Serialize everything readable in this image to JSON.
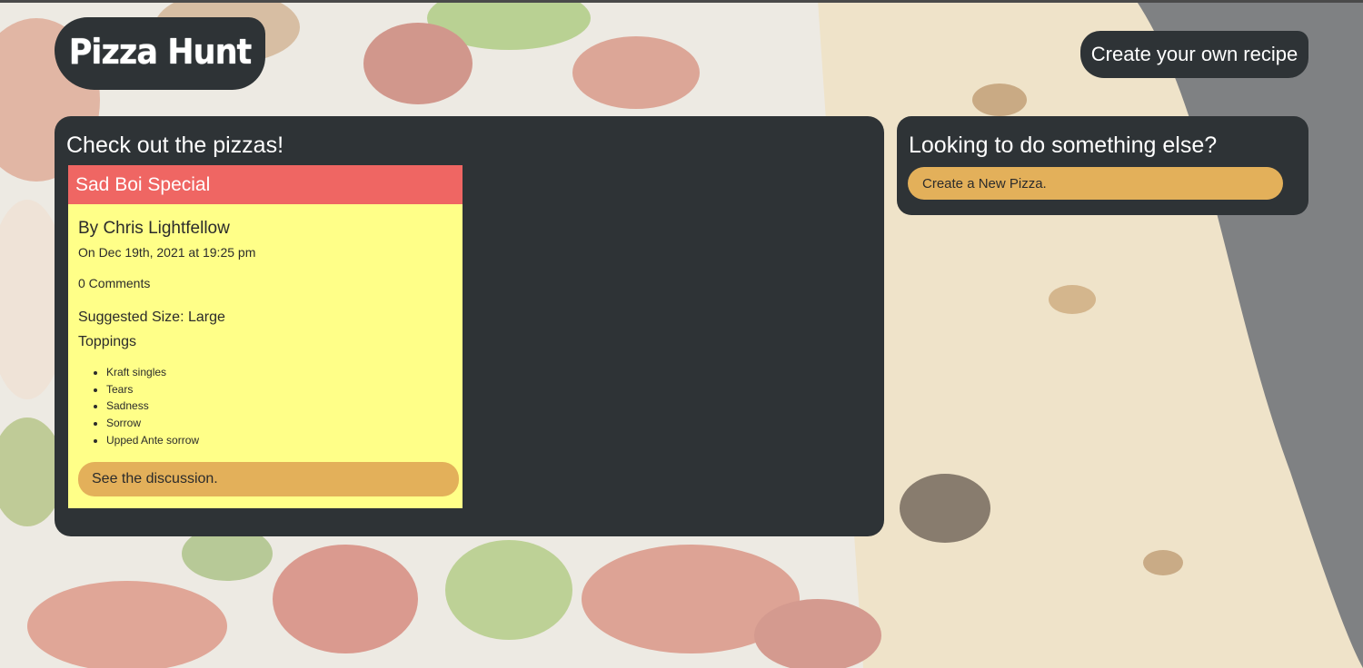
{
  "header": {
    "logo_text": "Pizza Hunt",
    "create_recipe_label": "Create your own recipe"
  },
  "main": {
    "title": "Check out the pizzas!",
    "pizzas": [
      {
        "name": "Sad Boi Special",
        "author": "By Chris Lightfellow",
        "date": "On Dec 19th, 2021 at 19:25 pm",
        "comments": "0 Comments",
        "size": "Suggested Size: Large",
        "toppings_title": "Toppings",
        "toppings": [
          "Kraft singles",
          "Tears",
          "Sadness",
          "Sorrow",
          "Upped Ante sorrow"
        ],
        "discussion_label": "See the discussion."
      }
    ]
  },
  "sidebar": {
    "title": "Looking to do something else?",
    "new_pizza_label": "Create a New Pizza."
  },
  "colors": {
    "panel": "#2e3336",
    "card_header": "#ef6663",
    "card_body": "#ffff88",
    "button": "#e3b05a"
  }
}
